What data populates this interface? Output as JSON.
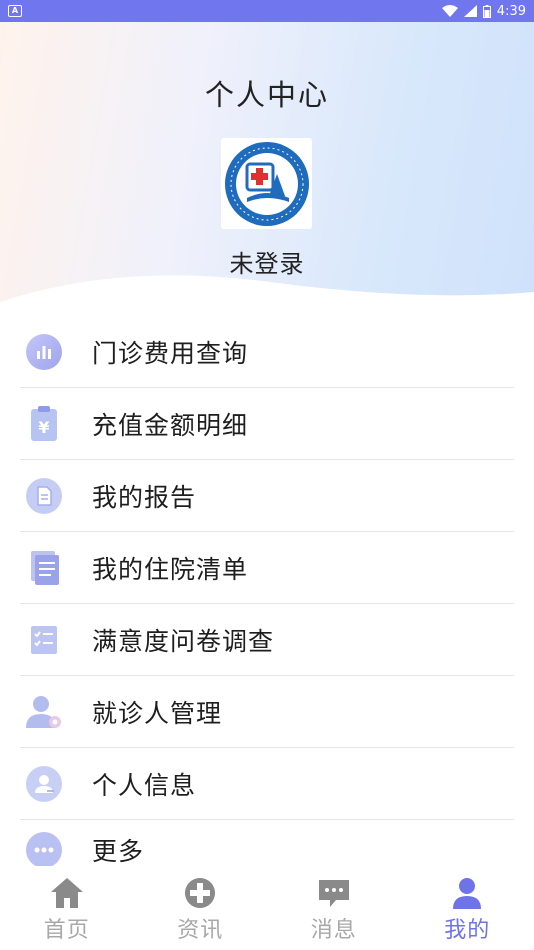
{
  "status_bar": {
    "time": "4:39",
    "badge": "A",
    "color": "#6f76ee"
  },
  "header": {
    "title": "个人中心",
    "login_status": "未登录",
    "logo_icon": "hospital-logo"
  },
  "menu": {
    "items": [
      {
        "label": "门诊费用查询",
        "icon": "bar-chart-icon"
      },
      {
        "label": "充值金额明细",
        "icon": "yuan-clipboard-icon"
      },
      {
        "label": "我的报告",
        "icon": "report-icon"
      },
      {
        "label": "我的住院清单",
        "icon": "document-list-icon"
      },
      {
        "label": "满意度问卷调查",
        "icon": "checklist-icon"
      },
      {
        "label": "就诊人管理",
        "icon": "user-settings-icon"
      },
      {
        "label": "个人信息",
        "icon": "profile-icon"
      },
      {
        "label": "更多",
        "icon": "more-icon"
      }
    ]
  },
  "tabbar": {
    "tabs": [
      {
        "label": "首页",
        "icon": "home-icon",
        "active": false
      },
      {
        "label": "资讯",
        "icon": "news-icon",
        "active": false
      },
      {
        "label": "消息",
        "icon": "message-icon",
        "active": false
      },
      {
        "label": "我的",
        "icon": "person-icon",
        "active": true
      }
    ],
    "active_color": "#6e73ea",
    "inactive_color": "#a8a8a8"
  }
}
